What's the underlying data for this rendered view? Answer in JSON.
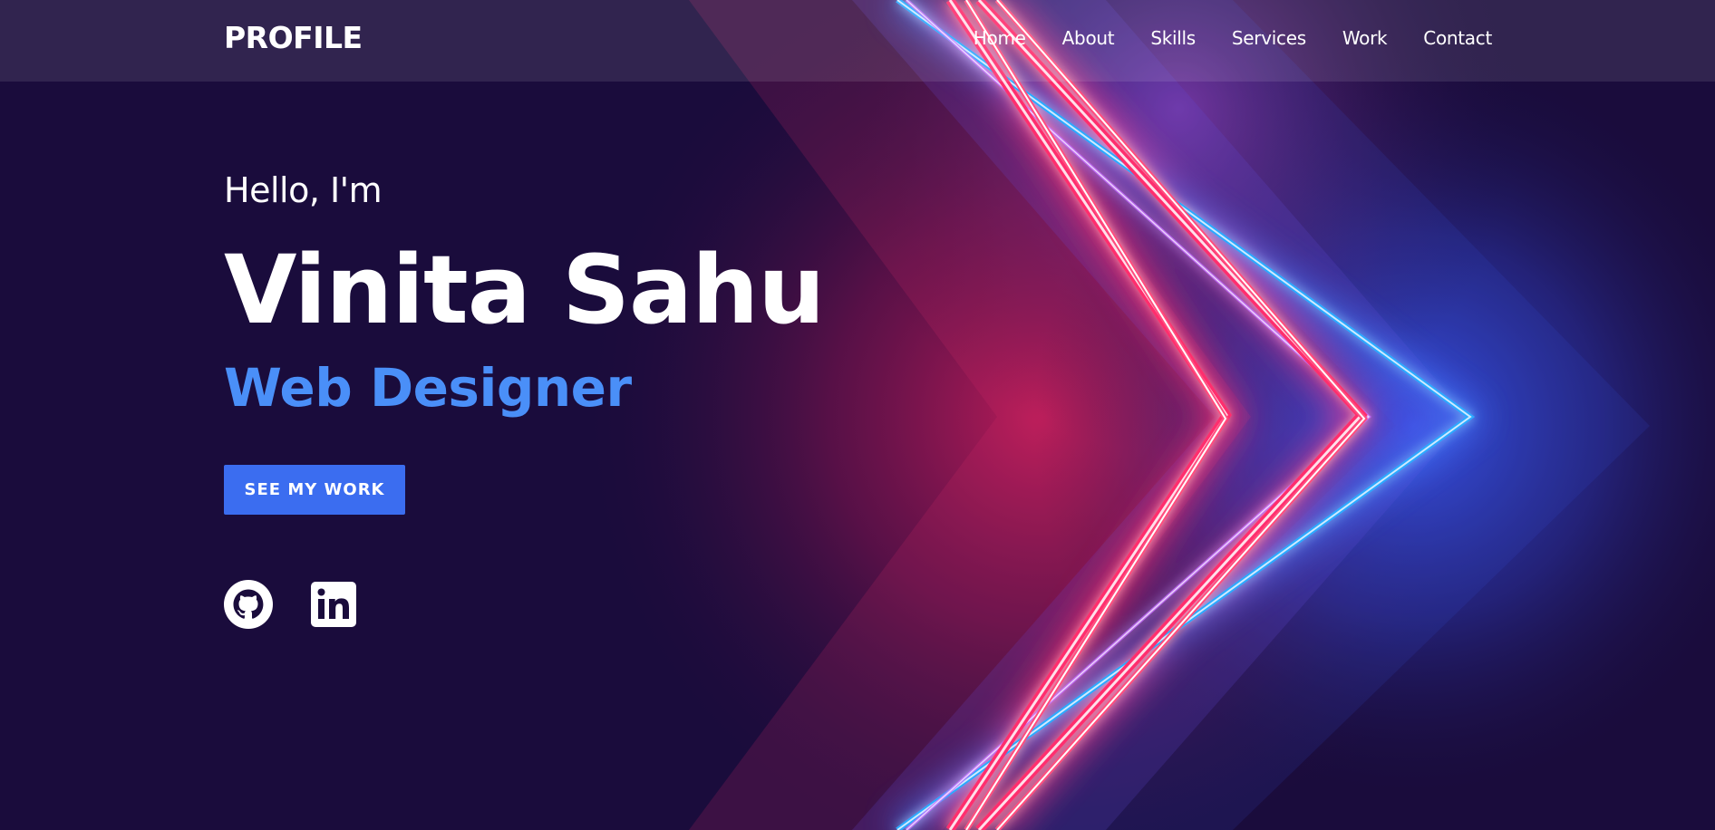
{
  "header": {
    "logo": "PROFILE",
    "nav": [
      "Home",
      "About",
      "Skills",
      "Services",
      "Work",
      "Contact"
    ]
  },
  "hero": {
    "greeting": "Hello, I'm",
    "name": "Vinita Sahu",
    "role": "Web Designer",
    "cta_label": "SEE MY WORK"
  },
  "socials": [
    {
      "icon": "github-icon"
    },
    {
      "icon": "linkedin-icon"
    }
  ],
  "colors": {
    "background": "#1a0c3c",
    "accent": "#4a8ff8",
    "button": "#3b6df0",
    "neon_pink": "#ff2d6e",
    "neon_blue": "#2aa9ff"
  }
}
